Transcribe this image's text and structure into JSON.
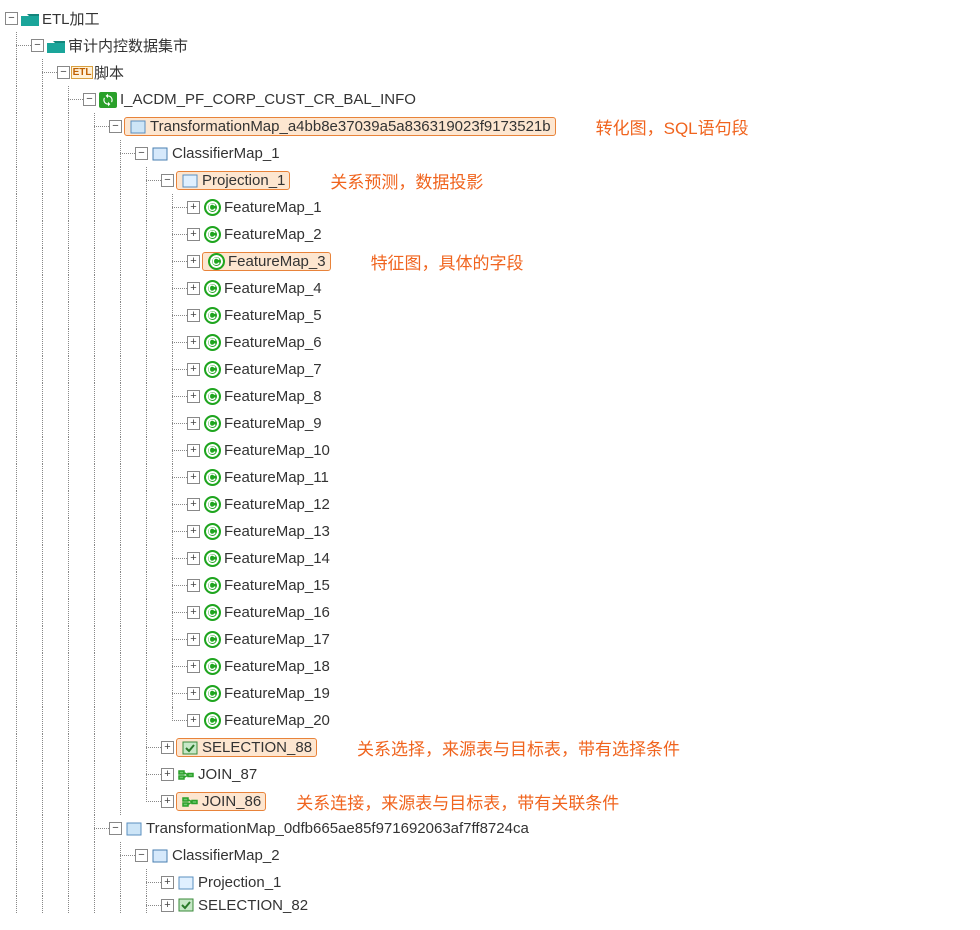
{
  "tree": {
    "root": {
      "label": "ETL加工"
    },
    "l1": {
      "label": "审计内控数据集市"
    },
    "l2": {
      "label": "脚本"
    },
    "l3": {
      "label": "I_ACDM_PF_CORP_CUST_CR_BAL_INFO"
    },
    "tmap1": {
      "label": "TransformationMap_a4bb8e37039a5a836319023f9173521b"
    },
    "cmap1": {
      "label": "ClassifierMap_1"
    },
    "proj1": {
      "label": "Projection_1"
    },
    "features": [
      "FeatureMap_1",
      "FeatureMap_2",
      "FeatureMap_3",
      "FeatureMap_4",
      "FeatureMap_5",
      "FeatureMap_6",
      "FeatureMap_7",
      "FeatureMap_8",
      "FeatureMap_9",
      "FeatureMap_10",
      "FeatureMap_11",
      "FeatureMap_12",
      "FeatureMap_13",
      "FeatureMap_14",
      "FeatureMap_15",
      "FeatureMap_16",
      "FeatureMap_17",
      "FeatureMap_18",
      "FeatureMap_19",
      "FeatureMap_20"
    ],
    "sel88": {
      "label": "SELECTION_88"
    },
    "join87": {
      "label": "JOIN_87"
    },
    "join86": {
      "label": "JOIN_86"
    },
    "tmap2": {
      "label": "TransformationMap_0dfb665ae85f971692063af7ff8724ca"
    },
    "cmap2": {
      "label": "ClassifierMap_2"
    },
    "proj2": {
      "label": "Projection_1"
    },
    "sel82": {
      "label": "SELECTION_82"
    }
  },
  "annotations": {
    "tmap": "转化图，SQL语句段",
    "proj": "关系预测，数据投影",
    "feat": "特征图，具体的字段",
    "sel": "关系选择，来源表与目标表，带有选择条件",
    "join": "关系连接，来源表与目标表，带有关联条件"
  },
  "glyphs": {
    "plus": "+",
    "minus": "−"
  }
}
